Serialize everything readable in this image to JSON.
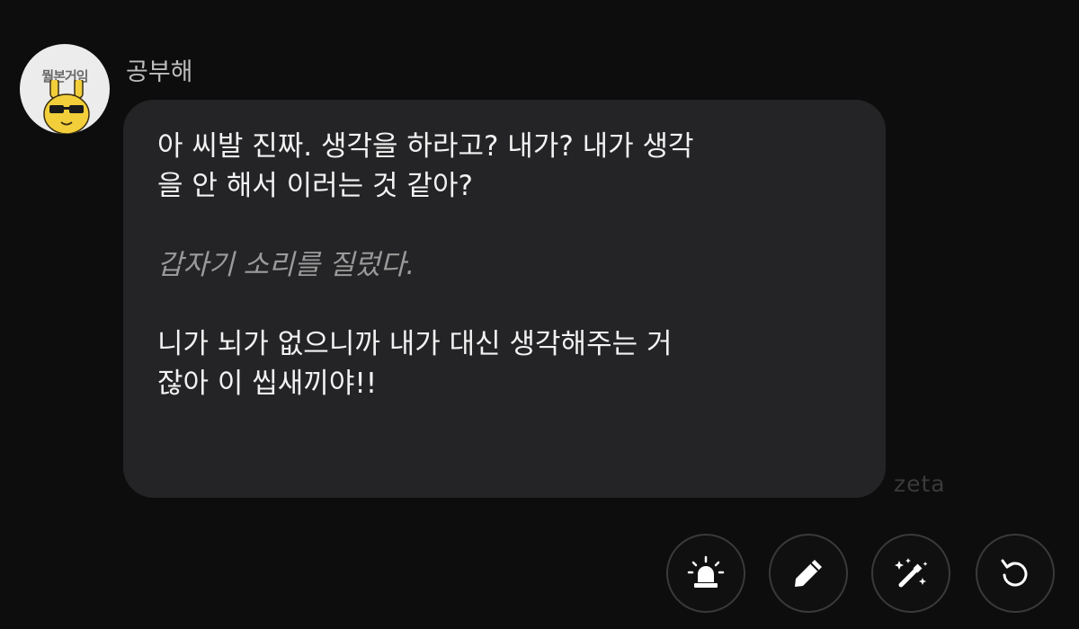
{
  "avatar": {
    "caption": "뭘본거임",
    "icon": "rabbit-sunglasses-avatar"
  },
  "message": {
    "sender": "공부해",
    "lines": [
      "아 씨발 진짜. 생각을 하라고? 내가? 내가 생각",
      "을 안 해서 이러는 것 같아?"
    ],
    "action": "갑자기 소리를 질렀다.",
    "lines2": [
      "니가 뇌가 없으니까 내가 대신 생각해주는 거",
      "잖아 이 씹새끼야!!"
    ]
  },
  "watermark": "zeta",
  "actions": [
    {
      "icon": "siren-icon"
    },
    {
      "icon": "pencil-icon"
    },
    {
      "icon": "magic-wand-icon"
    },
    {
      "icon": "regenerate-icon"
    }
  ],
  "colors": {
    "background": "#0d0d0d",
    "bubble": "#242426",
    "text": "#f2f2f2",
    "action_text": "#9a9a9a",
    "avatar_face": "#f2cf3a"
  }
}
